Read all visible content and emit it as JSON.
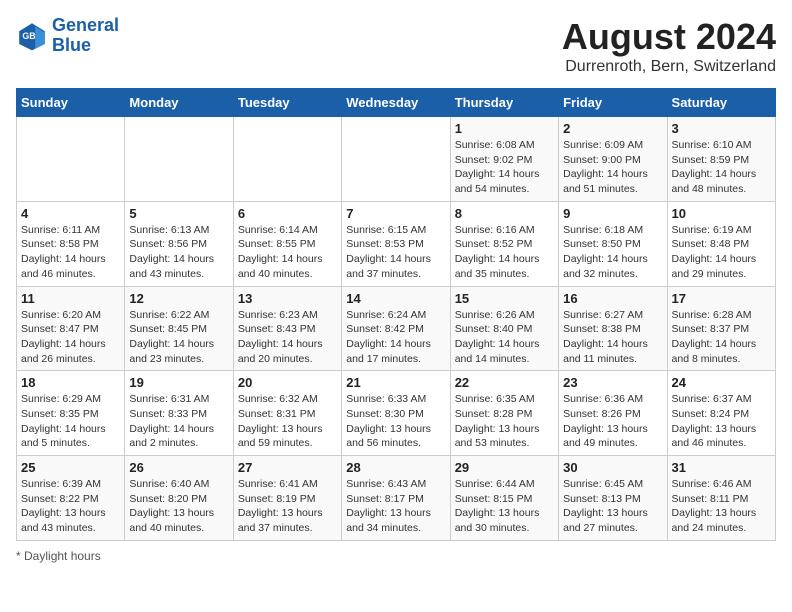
{
  "header": {
    "logo_line1": "General",
    "logo_line2": "Blue",
    "title": "August 2024",
    "subtitle": "Durrenroth, Bern, Switzerland"
  },
  "footer": {
    "note": "Daylight hours"
  },
  "days_of_week": [
    "Sunday",
    "Monday",
    "Tuesday",
    "Wednesday",
    "Thursday",
    "Friday",
    "Saturday"
  ],
  "weeks": [
    [
      {
        "day": "",
        "info": ""
      },
      {
        "day": "",
        "info": ""
      },
      {
        "day": "",
        "info": ""
      },
      {
        "day": "",
        "info": ""
      },
      {
        "day": "1",
        "info": "Sunrise: 6:08 AM\nSunset: 9:02 PM\nDaylight: 14 hours\nand 54 minutes."
      },
      {
        "day": "2",
        "info": "Sunrise: 6:09 AM\nSunset: 9:00 PM\nDaylight: 14 hours\nand 51 minutes."
      },
      {
        "day": "3",
        "info": "Sunrise: 6:10 AM\nSunset: 8:59 PM\nDaylight: 14 hours\nand 48 minutes."
      }
    ],
    [
      {
        "day": "4",
        "info": "Sunrise: 6:11 AM\nSunset: 8:58 PM\nDaylight: 14 hours\nand 46 minutes."
      },
      {
        "day": "5",
        "info": "Sunrise: 6:13 AM\nSunset: 8:56 PM\nDaylight: 14 hours\nand 43 minutes."
      },
      {
        "day": "6",
        "info": "Sunrise: 6:14 AM\nSunset: 8:55 PM\nDaylight: 14 hours\nand 40 minutes."
      },
      {
        "day": "7",
        "info": "Sunrise: 6:15 AM\nSunset: 8:53 PM\nDaylight: 14 hours\nand 37 minutes."
      },
      {
        "day": "8",
        "info": "Sunrise: 6:16 AM\nSunset: 8:52 PM\nDaylight: 14 hours\nand 35 minutes."
      },
      {
        "day": "9",
        "info": "Sunrise: 6:18 AM\nSunset: 8:50 PM\nDaylight: 14 hours\nand 32 minutes."
      },
      {
        "day": "10",
        "info": "Sunrise: 6:19 AM\nSunset: 8:48 PM\nDaylight: 14 hours\nand 29 minutes."
      }
    ],
    [
      {
        "day": "11",
        "info": "Sunrise: 6:20 AM\nSunset: 8:47 PM\nDaylight: 14 hours\nand 26 minutes."
      },
      {
        "day": "12",
        "info": "Sunrise: 6:22 AM\nSunset: 8:45 PM\nDaylight: 14 hours\nand 23 minutes."
      },
      {
        "day": "13",
        "info": "Sunrise: 6:23 AM\nSunset: 8:43 PM\nDaylight: 14 hours\nand 20 minutes."
      },
      {
        "day": "14",
        "info": "Sunrise: 6:24 AM\nSunset: 8:42 PM\nDaylight: 14 hours\nand 17 minutes."
      },
      {
        "day": "15",
        "info": "Sunrise: 6:26 AM\nSunset: 8:40 PM\nDaylight: 14 hours\nand 14 minutes."
      },
      {
        "day": "16",
        "info": "Sunrise: 6:27 AM\nSunset: 8:38 PM\nDaylight: 14 hours\nand 11 minutes."
      },
      {
        "day": "17",
        "info": "Sunrise: 6:28 AM\nSunset: 8:37 PM\nDaylight: 14 hours\nand 8 minutes."
      }
    ],
    [
      {
        "day": "18",
        "info": "Sunrise: 6:29 AM\nSunset: 8:35 PM\nDaylight: 14 hours\nand 5 minutes."
      },
      {
        "day": "19",
        "info": "Sunrise: 6:31 AM\nSunset: 8:33 PM\nDaylight: 14 hours\nand 2 minutes."
      },
      {
        "day": "20",
        "info": "Sunrise: 6:32 AM\nSunset: 8:31 PM\nDaylight: 13 hours\nand 59 minutes."
      },
      {
        "day": "21",
        "info": "Sunrise: 6:33 AM\nSunset: 8:30 PM\nDaylight: 13 hours\nand 56 minutes."
      },
      {
        "day": "22",
        "info": "Sunrise: 6:35 AM\nSunset: 8:28 PM\nDaylight: 13 hours\nand 53 minutes."
      },
      {
        "day": "23",
        "info": "Sunrise: 6:36 AM\nSunset: 8:26 PM\nDaylight: 13 hours\nand 49 minutes."
      },
      {
        "day": "24",
        "info": "Sunrise: 6:37 AM\nSunset: 8:24 PM\nDaylight: 13 hours\nand 46 minutes."
      }
    ],
    [
      {
        "day": "25",
        "info": "Sunrise: 6:39 AM\nSunset: 8:22 PM\nDaylight: 13 hours\nand 43 minutes."
      },
      {
        "day": "26",
        "info": "Sunrise: 6:40 AM\nSunset: 8:20 PM\nDaylight: 13 hours\nand 40 minutes."
      },
      {
        "day": "27",
        "info": "Sunrise: 6:41 AM\nSunset: 8:19 PM\nDaylight: 13 hours\nand 37 minutes."
      },
      {
        "day": "28",
        "info": "Sunrise: 6:43 AM\nSunset: 8:17 PM\nDaylight: 13 hours\nand 34 minutes."
      },
      {
        "day": "29",
        "info": "Sunrise: 6:44 AM\nSunset: 8:15 PM\nDaylight: 13 hours\nand 30 minutes."
      },
      {
        "day": "30",
        "info": "Sunrise: 6:45 AM\nSunset: 8:13 PM\nDaylight: 13 hours\nand 27 minutes."
      },
      {
        "day": "31",
        "info": "Sunrise: 6:46 AM\nSunset: 8:11 PM\nDaylight: 13 hours\nand 24 minutes."
      }
    ]
  ]
}
